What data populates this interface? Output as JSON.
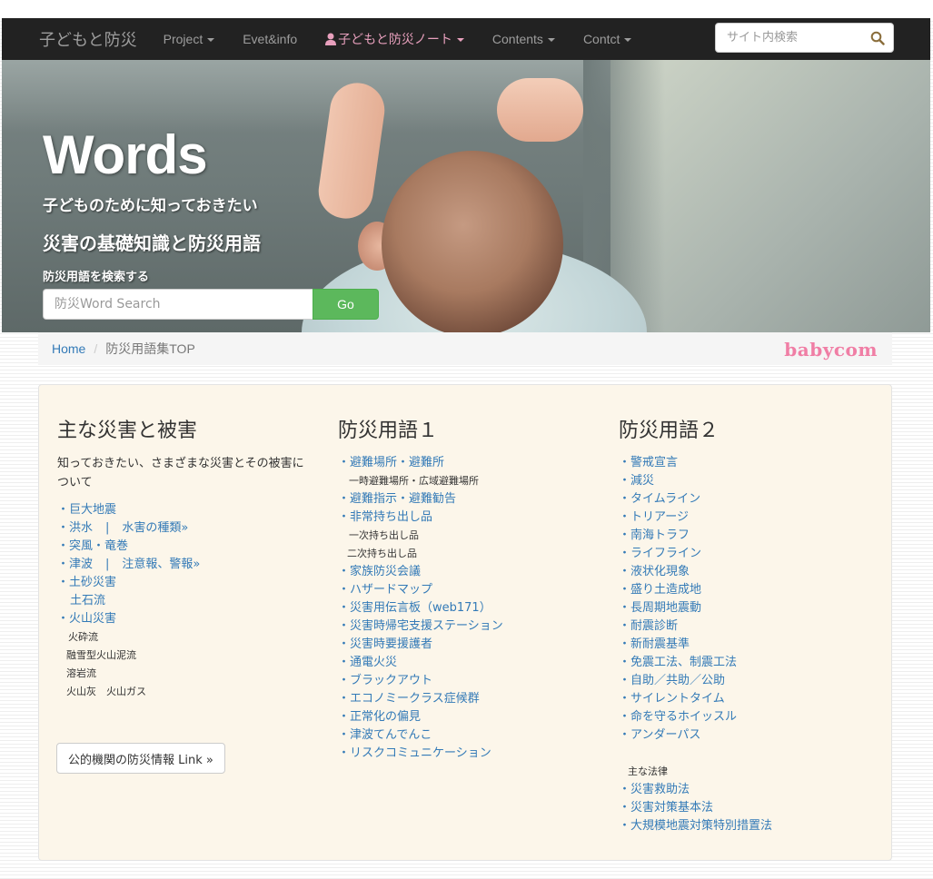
{
  "navbar": {
    "brand": "子どもと防災",
    "items": [
      {
        "label": "Project",
        "caret": true
      },
      {
        "label": "Evet&info",
        "caret": false
      },
      {
        "label": "子どもと防災ノート",
        "caret": true,
        "active": true
      },
      {
        "label": "Contents",
        "caret": true
      },
      {
        "label": "Contct",
        "caret": true
      }
    ],
    "search_placeholder": "サイト内検索"
  },
  "hero": {
    "title": "Words",
    "subtitle1": "子どものために知っておきたい",
    "subtitle2": "災害の基礎知識と防災用語",
    "search_label": "防災用語を検索する",
    "search_placeholder": "防災Word Search",
    "search_button": "Go"
  },
  "breadcrumb": {
    "home": "Home",
    "separator": "/",
    "current": "防災用語集TOP",
    "logo": "babycom"
  },
  "columns": {
    "col1": {
      "title": "主な災害と被害",
      "description": "知っておきたい、さまざまな災害とその被害について",
      "items": {
        "i0": "・巨大地震",
        "i1a": "・洪水",
        "i1sep": "|",
        "i1b": "水害の種類»",
        "i2": "・突風・竜巻",
        "i3a": "・津波",
        "i3sep": "|",
        "i3b": "注意報、警報»",
        "i4": "・土砂災害",
        "i5": "土石流",
        "i6": "・火山災害",
        "i7": "火砕流",
        "i8": "融雪型火山泥流",
        "i9": "溶岩流",
        "i10": "火山灰　火山ガス"
      },
      "button": "公的機関の防災情報 Link »"
    },
    "col2": {
      "title": "防災用語１",
      "items": {
        "i0": "・避難場所・避難所",
        "i1": "一時避難場所・広域避難場所",
        "i2": "・避難指示・避難勧告",
        "i3": "・非常持ち出し品",
        "i4": "一次持ち出し品",
        "i5": "二次持ち出し品",
        "i6": "・家族防災会議",
        "i7": "・ハザードマップ",
        "i8": "・災害用伝言板（web171）",
        "i9": "・災害時帰宅支援ステーション",
        "i10": "・災害時要援護者",
        "i11": "・通電火災",
        "i12": "・ブラックアウト",
        "i13": "・エコノミークラス症候群",
        "i14": "・正常化の偏見",
        "i15": "・津波てんでんこ",
        "i16": "・リスクコミュニケーション"
      }
    },
    "col3": {
      "title": "防災用語２",
      "items": {
        "i0": "・警戒宣言",
        "i1": "・減災",
        "i2": "・タイムライン",
        "i3": "・トリアージ",
        "i4": "・南海トラフ",
        "i5": "・ライフライン",
        "i6": "・液状化現象",
        "i7": "・盛り土造成地",
        "i8": "・長周期地震動",
        "i9": "・耐震診断",
        "i10": "・新耐震基準",
        "i11": "・免震工法、制震工法",
        "i12": "・自助／共助／公助",
        "i13": "・サイレントタイム",
        "i14": "・命を守るホイッスル",
        "i15": "・アンダーパス",
        "law_head": "主な法律",
        "l0": "・災害救助法",
        "l1": "・災害対策基本法",
        "l2": "・大規模地震対策特別措置法"
      }
    }
  },
  "colors": {
    "navbar_bg": "#222222",
    "link": "#337ab7",
    "active_nav": "#e8a0bd",
    "go_button": "#5cb85c",
    "logo": "#f07ea5",
    "well_bg": "#fcf6ea"
  },
  "icons": {
    "search": "search-icon",
    "user": "user-icon"
  }
}
